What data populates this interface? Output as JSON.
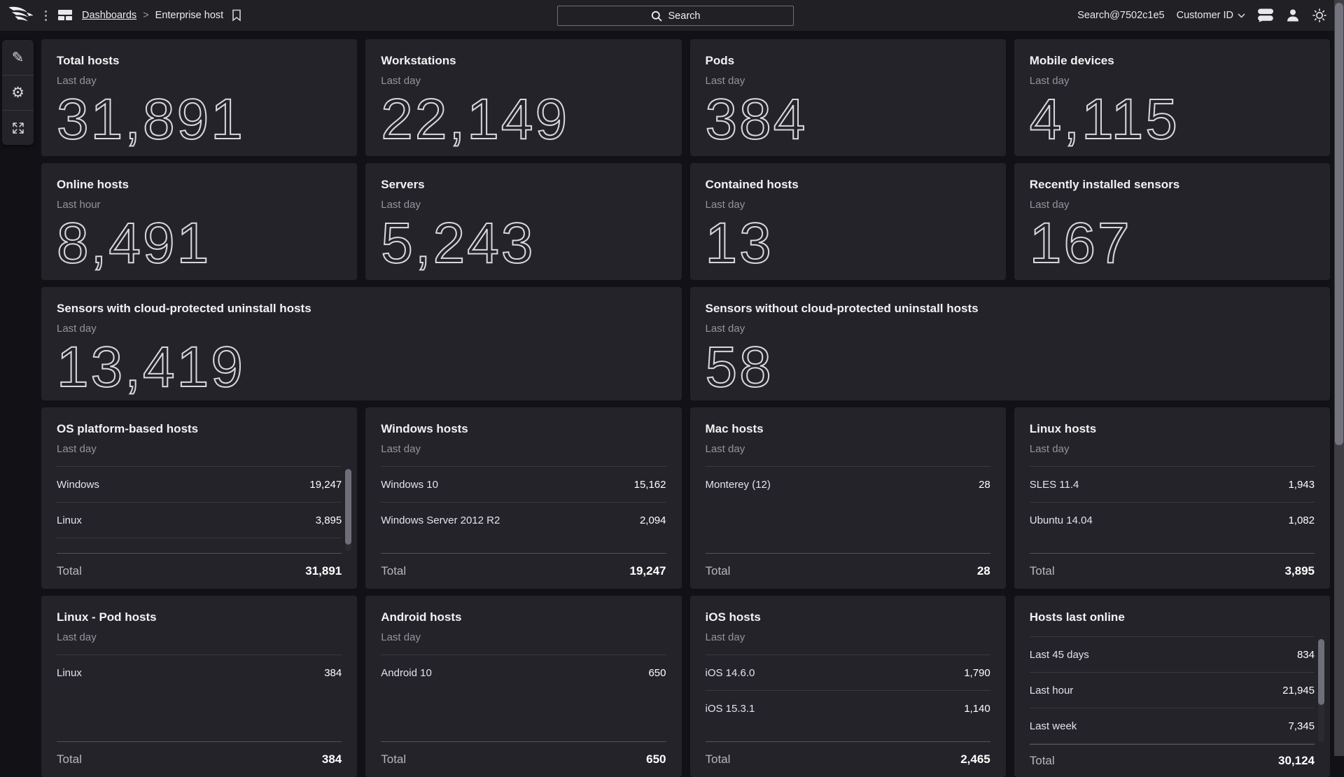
{
  "topbar": {
    "breadcrumb": {
      "root": "Dashboards",
      "separator": ">",
      "current": "Enterprise host"
    },
    "search_placeholder": "Search",
    "user": "Search@7502c1e5",
    "customer_label": "Customer ID"
  },
  "stat_cards": [
    {
      "title": "Total hosts",
      "subtitle": "Last day",
      "value": "31,891"
    },
    {
      "title": "Workstations",
      "subtitle": "Last day",
      "value": "22,149"
    },
    {
      "title": "Pods",
      "subtitle": "Last day",
      "value": "384"
    },
    {
      "title": "Mobile devices",
      "subtitle": "Last day",
      "value": "4,115"
    },
    {
      "title": "Online hosts",
      "subtitle": "Last hour",
      "value": "8,491"
    },
    {
      "title": "Servers",
      "subtitle": "Last day",
      "value": "5,243"
    },
    {
      "title": "Contained hosts",
      "subtitle": "Last day",
      "value": "13"
    },
    {
      "title": "Recently installed sensors",
      "subtitle": "Last day",
      "value": "167"
    }
  ],
  "wide_cards": [
    {
      "title": "Sensors with cloud-protected uninstall hosts",
      "subtitle": "Last day",
      "value": "13,419"
    },
    {
      "title": "Sensors without cloud-protected uninstall hosts",
      "subtitle": "Last day",
      "value": "58"
    }
  ],
  "table_cards": [
    {
      "title": "OS platform-based hosts",
      "subtitle": "Last day",
      "rows": [
        {
          "label": "Windows",
          "value": "19,247"
        },
        {
          "label": "Linux",
          "value": "3,895"
        }
      ],
      "total_label": "Total",
      "total": "31,891",
      "scrollbar_visible": true,
      "scrollbar_thumb_pct": 92
    },
    {
      "title": "Windows hosts",
      "subtitle": "Last day",
      "rows": [
        {
          "label": "Windows 10",
          "value": "15,162"
        },
        {
          "label": "Windows Server 2012 R2",
          "value": "2,094"
        }
      ],
      "total_label": "Total",
      "total": "19,247",
      "scrollbar_visible": false,
      "scrollbar_thumb_pct": 0
    },
    {
      "title": "Mac hosts",
      "subtitle": "Last day",
      "rows": [
        {
          "label": "Monterey (12)",
          "value": "28"
        }
      ],
      "total_label": "Total",
      "total": "28",
      "scrollbar_visible": false,
      "scrollbar_thumb_pct": 0
    },
    {
      "title": "Linux hosts",
      "subtitle": "Last day",
      "rows": [
        {
          "label": "SLES 11.4",
          "value": "1,943"
        },
        {
          "label": "Ubuntu 14.04",
          "value": "1,082"
        }
      ],
      "total_label": "Total",
      "total": "3,895",
      "scrollbar_visible": false,
      "scrollbar_thumb_pct": 0
    },
    {
      "title": "Linux - Pod hosts",
      "subtitle": "Last day",
      "rows": [
        {
          "label": "Linux",
          "value": "384"
        }
      ],
      "total_label": "Total",
      "total": "384",
      "scrollbar_visible": false,
      "scrollbar_thumb_pct": 0
    },
    {
      "title": "Android hosts",
      "subtitle": "Last day",
      "rows": [
        {
          "label": "Android 10",
          "value": "650"
        }
      ],
      "total_label": "Total",
      "total": "650",
      "scrollbar_visible": false,
      "scrollbar_thumb_pct": 0
    },
    {
      "title": "iOS hosts",
      "subtitle": "Last day",
      "rows": [
        {
          "label": "iOS 14.6.0",
          "value": "1,790"
        },
        {
          "label": "iOS 15.3.1",
          "value": "1,140"
        }
      ],
      "total_label": "Total",
      "total": "2,465",
      "scrollbar_visible": false,
      "scrollbar_thumb_pct": 0
    },
    {
      "title": "Hosts last online",
      "subtitle": "",
      "rows": [
        {
          "label": "Last 45 days",
          "value": "834"
        },
        {
          "label": "Last hour",
          "value": "21,945"
        },
        {
          "label": "Last week",
          "value": "7,345"
        }
      ],
      "total_label": "Total",
      "total": "30,124",
      "scrollbar_visible": true,
      "scrollbar_thumb_pct": 64
    }
  ],
  "colors": {
    "page_bg": "#121216",
    "topbar_bg": "#202025",
    "card_bg": "#232329",
    "title_text": "#f2f2f4",
    "subtitle_text": "#94949c",
    "metric_stroke": "#d8d8dc",
    "row_link": "#e3e3f0",
    "separator": "#38383e",
    "total_separator": "#52525a",
    "scrollbar_thumb": "#74747e"
  }
}
